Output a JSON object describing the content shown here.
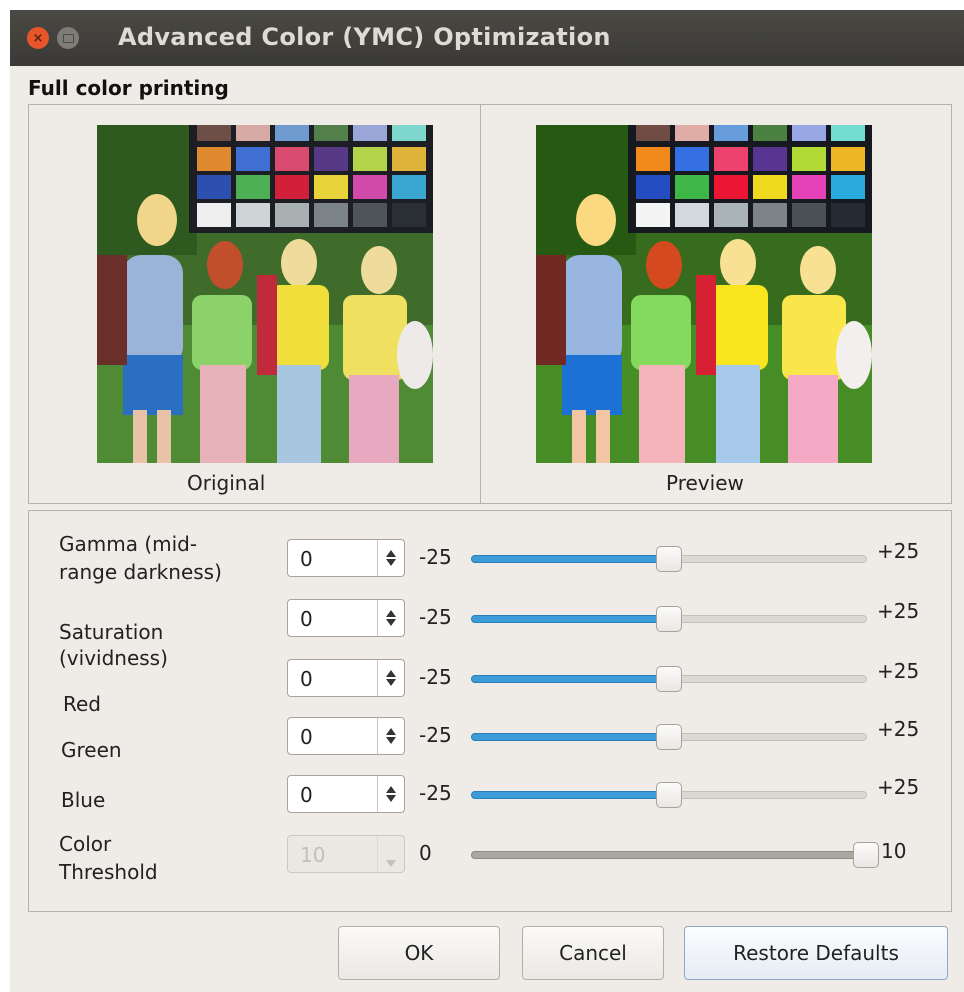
{
  "window": {
    "title": "Advanced Color (YMC) Optimization",
    "close_glyph": "×"
  },
  "section_label": "Full color printing",
  "previews": {
    "original_caption": "Original",
    "preview_caption": "Preview"
  },
  "controls": [
    {
      "label_lines": [
        "Gamma (mid-",
        "range darkness)"
      ],
      "value": "0",
      "min_label": "-25",
      "max_label": "+25",
      "slider_fraction": 0.5
    },
    {
      "label_lines": [
        "Saturation",
        "(vividness)"
      ],
      "value": "0",
      "min_label": "-25",
      "max_label": "+25",
      "slider_fraction": 0.5
    },
    {
      "label_lines": [
        "Red"
      ],
      "value": "0",
      "min_label": "-25",
      "max_label": "+25",
      "slider_fraction": 0.5
    },
    {
      "label_lines": [
        "Green"
      ],
      "value": "0",
      "min_label": "-25",
      "max_label": "+25",
      "slider_fraction": 0.5
    },
    {
      "label_lines": [
        "Blue"
      ],
      "value": "0",
      "min_label": "-25",
      "max_label": "+25",
      "slider_fraction": 0.5
    },
    {
      "label_lines": [
        "Color",
        "Threshold"
      ],
      "value": "10",
      "min_label": "0",
      "max_label": "10",
      "slider_fraction": 1.0,
      "disabled": true
    }
  ],
  "buttons": {
    "ok": "OK",
    "cancel": "Cancel",
    "restore": "Restore Defaults"
  },
  "colors": {
    "titlebar": "#3f3e3a",
    "window_bg": "#efebe7",
    "slider_fill": "#3d9bd9",
    "close_button": "#e9552a"
  },
  "icons": [
    "close-icon",
    "maximize-icon",
    "spin-up-icon",
    "spin-down-icon"
  ]
}
